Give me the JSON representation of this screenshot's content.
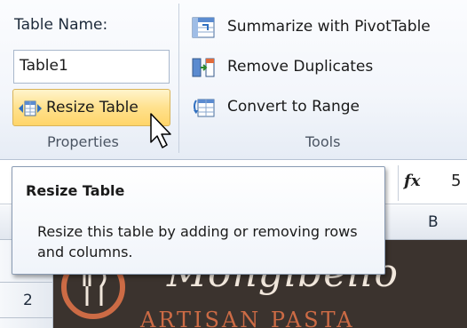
{
  "ribbon": {
    "properties": {
      "table_name_label": "Table Name:",
      "table_name_value": "Table1",
      "resize_button_label": "Resize Table",
      "group_label": "Properties"
    },
    "tools": {
      "items": [
        {
          "label": "Summarize with PivotTable",
          "icon": "pivottable-icon"
        },
        {
          "label": "Remove Duplicates",
          "icon": "remove-duplicates-icon"
        },
        {
          "label": "Convert to Range",
          "icon": "convert-to-range-icon"
        }
      ],
      "group_label": "Tools"
    }
  },
  "formula_bar": {
    "fx_symbol": "fx",
    "value": "5"
  },
  "grid": {
    "column_headers": [
      "B"
    ],
    "row_headers": [
      "2"
    ]
  },
  "tooltip": {
    "title": "Resize Table",
    "description": "Resize this table by adding or removing rows and columns."
  },
  "image": {
    "brand_name": "Mongibello",
    "brand_tagline": "ARTISAN PASTA"
  },
  "colors": {
    "hover_button": "#ffe18d",
    "ribbon_bg": "#f3f6fb",
    "brand_bg": "#3b332e",
    "brand_accent": "#cc6b45"
  }
}
